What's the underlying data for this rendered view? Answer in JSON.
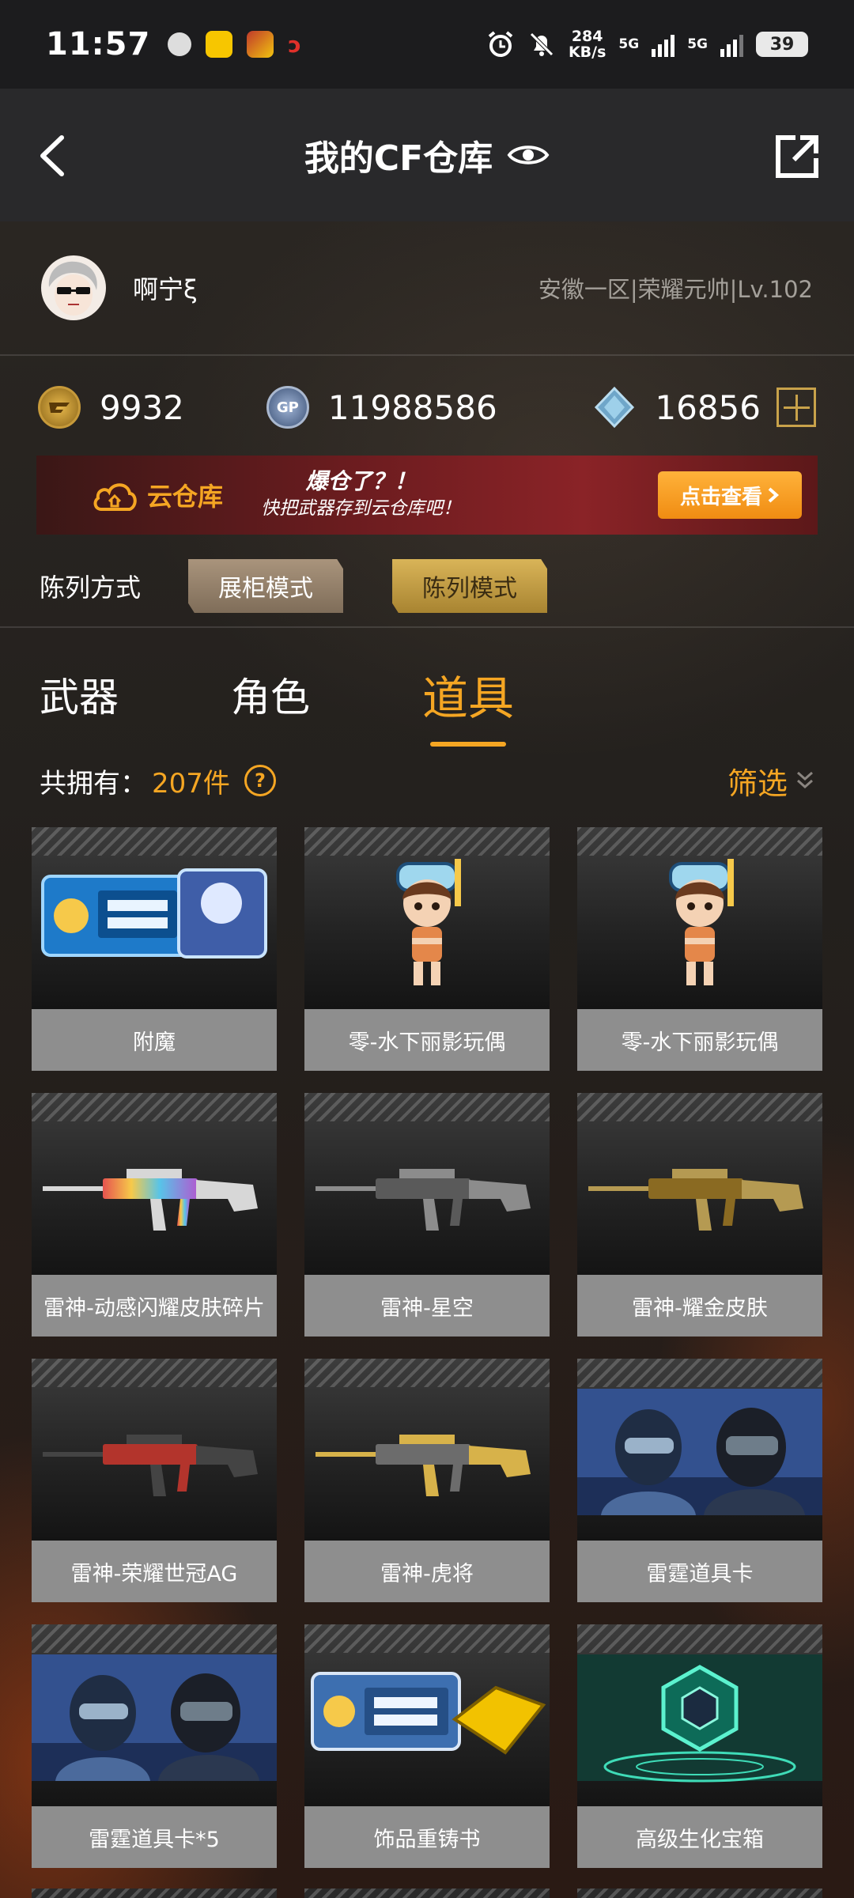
{
  "status_bar": {
    "time": "11:57",
    "net_speed_value": "284",
    "net_speed_unit": "KB/s",
    "sim1": "5G",
    "sim2": "5G",
    "battery": "39"
  },
  "header": {
    "title": "我的CF仓库"
  },
  "profile": {
    "username": "啊宁ξ",
    "server_info": "安徽一区|荣耀元帅|Lv.102"
  },
  "currency": {
    "cf_points": "9932",
    "gp": "11988586",
    "diamonds": "16856",
    "gp_label": "GP"
  },
  "banner": {
    "cloud_label": "云仓库",
    "slogan_line1": "爆仓了？！",
    "slogan_line2": "快把武器存到云仓库吧！",
    "button": "点击查看"
  },
  "display_mode": {
    "label": "陈列方式",
    "options": [
      "展柜模式",
      "陈列模式"
    ],
    "selected": "陈列模式"
  },
  "tabs": [
    {
      "label": "武器"
    },
    {
      "label": "角色"
    },
    {
      "label": "道具"
    }
  ],
  "active_tab": "道具",
  "summary": {
    "label": "共拥有：",
    "count": "207件",
    "filter_label": "筛选"
  },
  "items": [
    {
      "name": "附魔",
      "image": "enchant-book"
    },
    {
      "name": "零-水下丽影玩偶",
      "image": "diver-doll"
    },
    {
      "name": "零-水下丽影玩偶",
      "image": "diver-doll"
    },
    {
      "name": "雷神-动感闪耀皮肤碎片",
      "image": "rifle-rainbow"
    },
    {
      "name": "雷神-星空",
      "image": "rifle-silver"
    },
    {
      "name": "雷神-耀金皮肤",
      "image": "rifle-gold"
    },
    {
      "name": "雷神-荣耀世冠AG",
      "image": "rifle-red"
    },
    {
      "name": "雷神-虎将",
      "image": "rifle-tiger"
    },
    {
      "name": "雷霆道具卡",
      "image": "soldier-card"
    },
    {
      "name": "雷霆道具卡*5",
      "image": "soldier-card"
    },
    {
      "name": "饰品重铸书",
      "image": "recast-book"
    },
    {
      "name": "高级生化宝箱",
      "image": "bio-box"
    }
  ],
  "colors": {
    "accent": "#f5a623",
    "label_bg": "#8e8e8e",
    "topbar_bg": "#29292b"
  }
}
